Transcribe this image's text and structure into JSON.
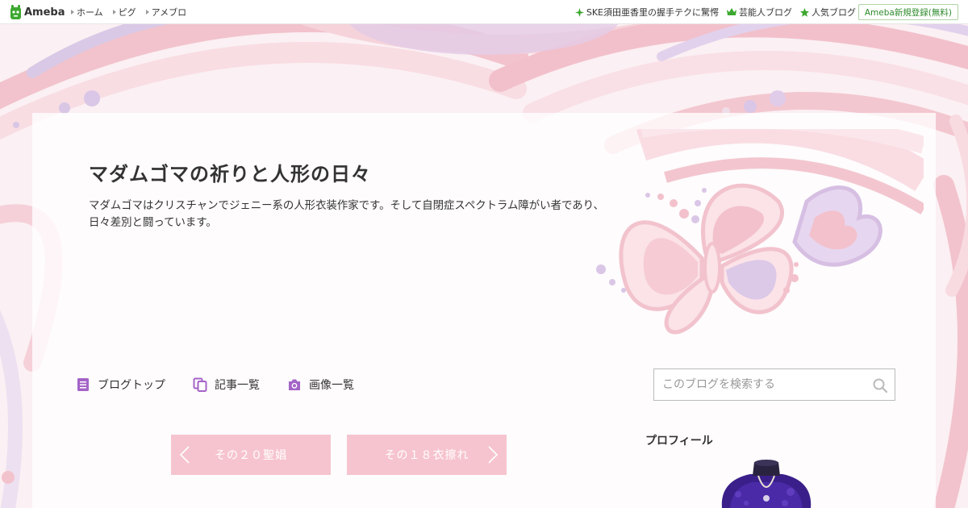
{
  "header": {
    "brand": "Ameba",
    "nav": [
      "ホーム",
      "ピグ",
      "アメブロ"
    ],
    "right_links": [
      {
        "label": "SKE須田亜香里の握手テクに驚愕",
        "icon": "sparkle-icon"
      },
      {
        "label": "芸能人ブログ",
        "icon": "crown-icon"
      },
      {
        "label": "人気ブログ",
        "icon": "star-icon"
      }
    ],
    "signup": "Ameba新規登録(無料)"
  },
  "blog": {
    "title": "マダムゴマの祈りと人形の日々",
    "description": "マダムゴマはクリスチャンでジェニー系の人形衣装作家です。そして自閉症スペクトラム障がい者であり、日々差別と闘っています。"
  },
  "blog_nav": [
    {
      "label": "ブログトップ",
      "icon": "document-icon"
    },
    {
      "label": "記事一覧",
      "icon": "articles-icon"
    },
    {
      "label": "画像一覧",
      "icon": "camera-icon"
    }
  ],
  "search": {
    "placeholder": "このブログを検索する"
  },
  "pager": {
    "prev": "その２０聖娼",
    "next": "その１８衣擦れ"
  },
  "profile": {
    "heading": "プロフィール"
  },
  "colors": {
    "accent_purple": "#a463c7",
    "pager_pink": "#f6c4cf",
    "brand_green": "#2d8a2b"
  }
}
